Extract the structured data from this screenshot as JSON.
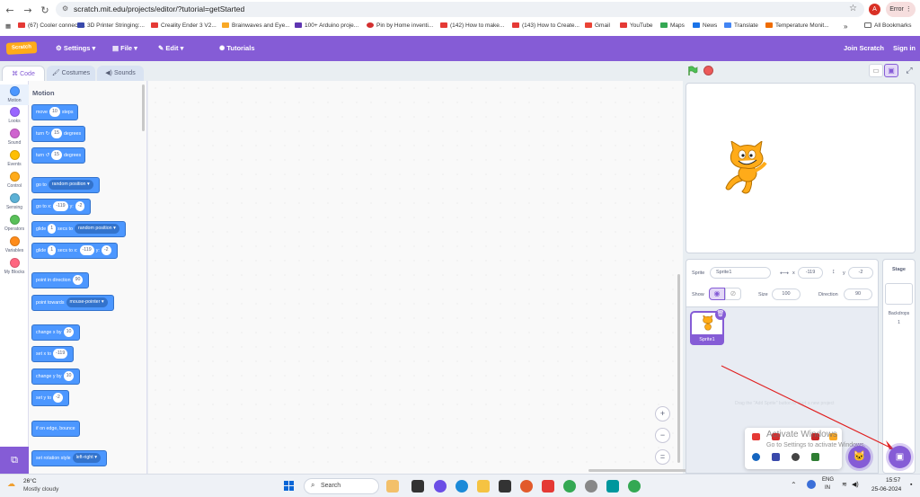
{
  "browser": {
    "url": "scratch.mit.edu/projects/editor/?tutorial=getStarted",
    "profile_initial": "A",
    "error_label": "Error",
    "bookmarks": [
      {
        "label": "(67) Cooler connecti...",
        "color": "#e53935"
      },
      {
        "label": "3D Printer Stringing:...",
        "color": "#3949ab"
      },
      {
        "label": "Creality Ender 3 V2...",
        "color": "#e53935"
      },
      {
        "label": "Brainwaves and Eye...",
        "color": "#f9a825"
      },
      {
        "label": "100+ Arduino proje...",
        "color": "#5e35b1"
      },
      {
        "label": "Pin by Home inventi...",
        "color": "#d32f2f"
      },
      {
        "label": "(142) How to make...",
        "color": "#e53935"
      },
      {
        "label": "(143) How to Create...",
        "color": "#e53935"
      },
      {
        "label": "Gmail",
        "color": "#ea4335"
      },
      {
        "label": "YouTube",
        "color": "#e53935"
      },
      {
        "label": "Maps",
        "color": "#34a853"
      },
      {
        "label": "News",
        "color": "#1a73e8"
      },
      {
        "label": "Translate",
        "color": "#4285f4"
      },
      {
        "label": "Temperature Monit...",
        "color": "#ef6c00"
      }
    ],
    "all_bookmarks": "All Bookmarks"
  },
  "menu": {
    "logo": "Scratch",
    "settings": "Settings",
    "file": "File",
    "edit": "Edit",
    "tutorials": "Tutorials",
    "join": "Join Scratch",
    "signin": "Sign in"
  },
  "tabs": {
    "code": "Code",
    "costumes": "Costumes",
    "sounds": "Sounds"
  },
  "categories": [
    {
      "label": "Motion",
      "color": "#4c97ff"
    },
    {
      "label": "Looks",
      "color": "#9966ff"
    },
    {
      "label": "Sound",
      "color": "#cf63cf"
    },
    {
      "label": "Events",
      "color": "#ffbf00"
    },
    {
      "label": "Control",
      "color": "#ffab19"
    },
    {
      "label": "Sensing",
      "color": "#5cb1d6"
    },
    {
      "label": "Operators",
      "color": "#59c059"
    },
    {
      "label": "Variables",
      "color": "#ff8c1a"
    },
    {
      "label": "My Blocks",
      "color": "#ff6680"
    }
  ],
  "palette": {
    "title": "Motion",
    "move": {
      "a": "move",
      "v": "10",
      "b": "steps"
    },
    "turn_right": {
      "a": "turn",
      "v": "15",
      "b": "degrees"
    },
    "turn_left": {
      "a": "turn",
      "v": "15",
      "b": "degrees"
    },
    "goto": {
      "a": "go to",
      "d": "random position"
    },
    "gotoxy": {
      "a": "go to x:",
      "x": "-119",
      "yl": "y:",
      "y": "-2"
    },
    "glide1": {
      "a": "glide",
      "v": "1",
      "b": "secs to",
      "d": "random position"
    },
    "glide2": {
      "a": "glide",
      "v": "1",
      "b": "secs to x:",
      "x": "-119",
      "yl": "y:",
      "y": "-2"
    },
    "point_dir": {
      "a": "point in direction",
      "v": "90"
    },
    "point_towards": {
      "a": "point towards",
      "d": "mouse-pointer"
    },
    "change_x": {
      "a": "change x by",
      "v": "10"
    },
    "set_x": {
      "a": "set x to",
      "v": "-119"
    },
    "change_y": {
      "a": "change y by",
      "v": "10"
    },
    "set_y": {
      "a": "set y to",
      "v": "-2"
    },
    "bounce": {
      "a": "if on edge, bounce"
    },
    "rotation": {
      "a": "set rotation style",
      "d": "left-right"
    }
  },
  "zoom": {
    "in": "+",
    "out": "−",
    "reset": "="
  },
  "sprite_info": {
    "sprite_label": "Sprite",
    "sprite_name": "Sprite1",
    "x_label": "x",
    "x": "-119",
    "y_label": "y",
    "y": "-2",
    "show_label": "Show",
    "size_label": "Size",
    "size": "100",
    "direction_label": "Direction",
    "direction": "90"
  },
  "sprite_tile": {
    "name": "Sprite1"
  },
  "stage_pane": {
    "title": "Stage",
    "backdrops_label": "Backdrops",
    "backdrops_count": "1"
  },
  "overlays": {
    "faint_hint": "Drag the \"Add Sprite\" button to start a new project",
    "activate_title": "Activate Windows",
    "activate_sub": "Go to Settings to activate Windows."
  },
  "taskbar": {
    "temp": "26°C",
    "weather": "Mostly cloudy",
    "search": "Search",
    "lang1": "ENG",
    "lang2": "IN",
    "time": "15:57",
    "date": "25-06-2024"
  }
}
